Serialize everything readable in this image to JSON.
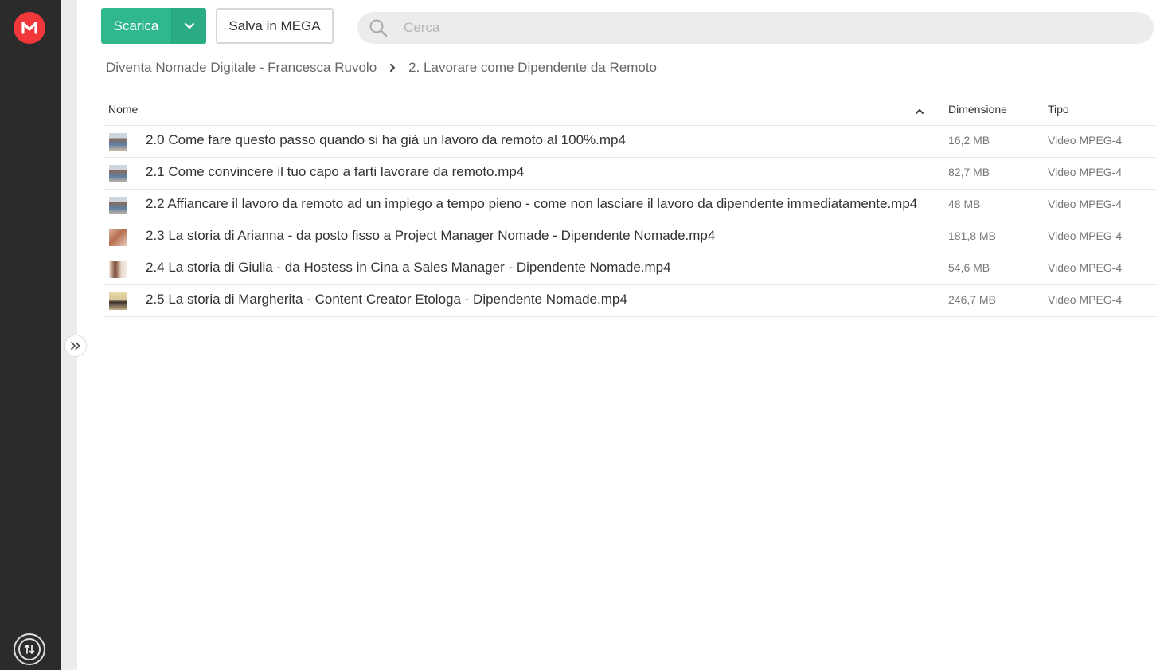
{
  "toolbar": {
    "download_label": "Scarica",
    "save_label": "Salva in MEGA"
  },
  "search": {
    "placeholder": "Cerca"
  },
  "breadcrumb": [
    "Diventa Nomade Digitale - Francesca Ruvolo",
    "2. Lavorare come Dipendente da Remoto"
  ],
  "table": {
    "columns": {
      "name": "Nome",
      "size": "Dimensione",
      "type": "Tipo"
    },
    "rows": [
      {
        "name": "2.0 Come fare questo passo quando si ha già un lavoro da remoto al 100%.mp4",
        "size": "16,2 MB",
        "type": "Video MPEG-4"
      },
      {
        "name": "2.1 Come convincere il tuo capo a farti lavorare da remoto.mp4",
        "size": "82,7 MB",
        "type": "Video MPEG-4"
      },
      {
        "name": "2.2 Affiancare il lavoro da remoto ad un impiego a tempo pieno - come non lasciare il lavoro da dipendente immediatamente.mp4",
        "size": "48 MB",
        "type": "Video MPEG-4"
      },
      {
        "name": "2.3 La storia di Arianna - da posto fisso a Project Manager Nomade - Dipendente Nomade.mp4",
        "size": "181,8 MB",
        "type": "Video MPEG-4"
      },
      {
        "name": "2.4 La storia di Giulia - da Hostess in Cina a Sales Manager - Dipendente Nomade.mp4",
        "size": "54,6 MB",
        "type": "Video MPEG-4"
      },
      {
        "name": "2.5 La storia di Margherita - Content Creator Etologa - Dipendente Nomade.mp4",
        "size": "246,7 MB",
        "type": "Video MPEG-4"
      }
    ]
  },
  "colors": {
    "brand": "#f0373a",
    "download_button": "#2fb78e",
    "rail": "#2b2b2b"
  },
  "icons": {
    "logo": "mega-logo-icon",
    "search": "search-icon",
    "dropdown": "chevron-down-icon",
    "breadcrumb_separator": "chevron-right-icon",
    "sort": "chevron-up-icon",
    "expand": "double-chevron-right-icon",
    "transfers": "transfers-icon"
  }
}
